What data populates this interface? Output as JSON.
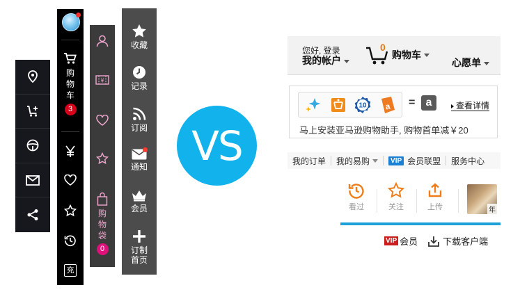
{
  "bar2": {
    "cart_label_chars": [
      "购",
      "物",
      "车"
    ],
    "cart_count": "3",
    "recharge_label": "充"
  },
  "bar3": {
    "bag_label_chars": [
      "购",
      "物",
      "袋"
    ],
    "bag_count": "0"
  },
  "bar4": {
    "items": [
      {
        "label": "收藏",
        "icon": "star-icon"
      },
      {
        "label": "记录",
        "icon": "clock-icon"
      },
      {
        "label": "订阅",
        "icon": "rss-icon"
      },
      {
        "label": "通知",
        "icon": "mail-icon"
      },
      {
        "label": "会员",
        "icon": "crown-icon"
      },
      {
        "label": "订制\n首页",
        "label_line1": "订制",
        "label_line2": "首页",
        "icon": "plus-icon"
      }
    ]
  },
  "vs_label": "VS",
  "amazon": {
    "greeting_small": "您好, 登录",
    "greeting_big": "我的帐户",
    "cart_count": "0",
    "cart_label": "购物车",
    "wishlist_label": "心愿单",
    "promo": {
      "badge_ten": "10",
      "equals": "=",
      "logo_letter": "a",
      "detail_link": "查看详情",
      "text": "马上安装亚马逊购物助手, 购物首单减￥20"
    },
    "nav": [
      {
        "label": "我的订单"
      },
      {
        "label": "我的易购"
      },
      {
        "label": "会员联盟",
        "badge": "VIP"
      },
      {
        "label": "服务中心"
      }
    ],
    "quick": [
      {
        "label": "看过",
        "icon": "history-icon"
      },
      {
        "label": "关注",
        "icon": "star-outline-icon"
      },
      {
        "label": "上传",
        "icon": "upload-icon"
      }
    ],
    "photo_tag": "年",
    "footer": {
      "vip_badge": "VIP",
      "member_label": "会员",
      "download_label": "下载客户端"
    }
  },
  "colors": {
    "vs_circle": "#12b3ec",
    "cart_badge": "#d7001a",
    "bag_badge": "#e0107b",
    "amazon_orange": "#e47911",
    "amazon_blue_line": "#1ea0d8"
  }
}
